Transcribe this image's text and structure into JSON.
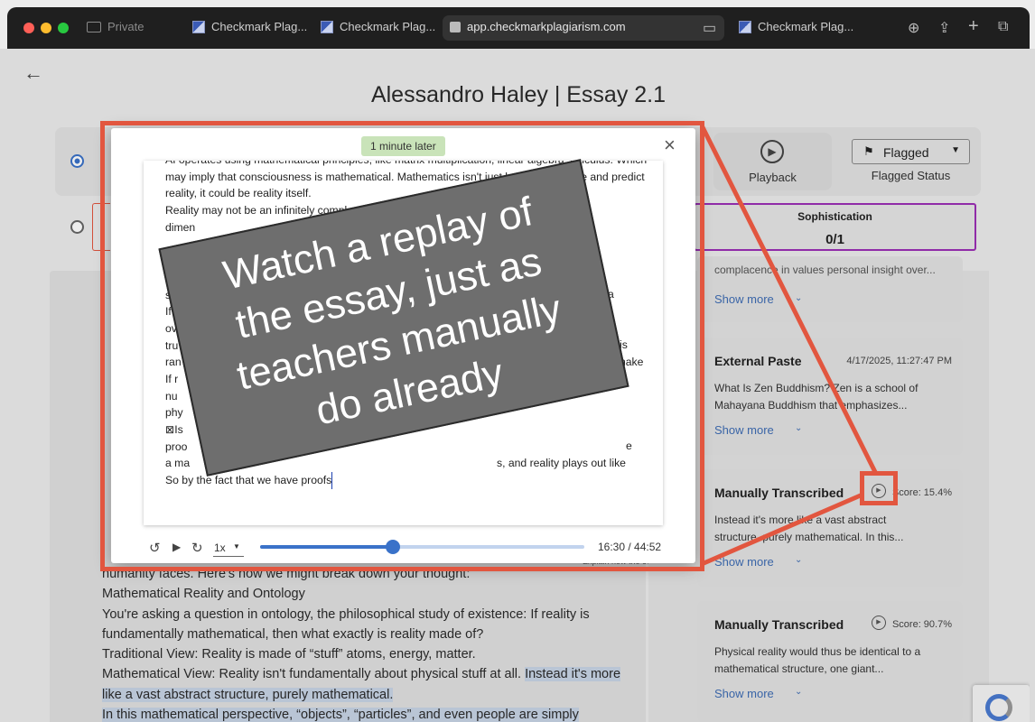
{
  "browser": {
    "private_label": "Private",
    "tabs": [
      {
        "label": "Checkmark Plag..."
      },
      {
        "label": "Checkmark Plag..."
      },
      {
        "label": "app.checkmarkplagiarism.com"
      },
      {
        "label": "Checkmark Plag..."
      }
    ]
  },
  "page": {
    "title": "Alessandro Haley | Essay 2.1"
  },
  "toolbar": {
    "playback_label": "Playback",
    "flag_value": "Flagged",
    "flag_caption": "Flagged Status",
    "sophistication_label": "Sophistication",
    "sophistication_value": "0/1"
  },
  "modal": {
    "badge": "1 minute later",
    "close": "×",
    "lines": [
      "AI operates using mathematical principles, like matrix multiplication, linear algebra, calculus. Which",
      "may imply that consciousness is mathematical. Mathematics isn't just how we describe and predict",
      "reality, it could be reality itself.",
      "Reality may not be an infinitely complex…",
      "dimen",
      "",
      "",
      "fu",
      "s",
      "If",
      "ov",
      "tru",
      "ran",
      "If r",
      "nu",
      "phy",
      "⊠Is",
      "proo",
      "a ma",
      "So by the fact that we have proofs"
    ],
    "right_fragments": {
      "line8": "a",
      "line10": "is",
      "line11": "nake",
      "line17": "e",
      "line18": "s, and reality plays out like"
    },
    "speed": "1x",
    "time": "16:30 / 44:52",
    "progress": 0.41
  },
  "overlay": {
    "line1": "Watch a replay of",
    "line2": "the essay, just as",
    "line3": "teachers manually",
    "line4": "do already"
  },
  "essay": {
    "l0": "humanity faces. Here's how we might break down your thought:",
    "l1": "Mathematical Reality and Ontology",
    "l2": "You're asking a question in ontology, the philosophical study of existence: If reality is",
    "l3": "fundamentally mathematical, then what exactly is reality made of?",
    "l4": "Traditional View: Reality is made of “stuff” atoms, energy, matter.",
    "l5a": "Mathematical View: Reality isn't fundamentally about physical stuff at all. ",
    "l5b": "Instead it's more",
    "l6": "like a vast abstract structure, purely mathematical.",
    "l7": "In this mathematical perspective, “objects”, “particles”, and even people are simply",
    "explain": "Explain how the evidence is"
  },
  "sidebar": {
    "top_snippet": "complacence in values personal insight over...",
    "show_more": "Show more",
    "cards": [
      {
        "title": "External Paste",
        "timestamp": "4/17/2025, 11:27:47 PM",
        "line1": "What Is Zen Buddhism? Zen is a school of",
        "line2": "Mahayana Buddhism that emphasizes..."
      },
      {
        "title": "Manually Transcribed",
        "score": "Score: 15.4%",
        "line1": "Instead it's more like a vast abstract",
        "line2": "structure, purely mathematical. In this..."
      },
      {
        "title": "Manually Transcribed",
        "score": "Score: 90.7%",
        "line1": "Physical reality would thus be identical to a",
        "line2": "mathematical structure, one giant..."
      }
    ]
  },
  "colors": {
    "accent": "#e2563f",
    "link": "#3f6db4",
    "badge_bg": "#c9e3b9",
    "slider": "#3a72c9",
    "purple": "#9b2fb5"
  }
}
